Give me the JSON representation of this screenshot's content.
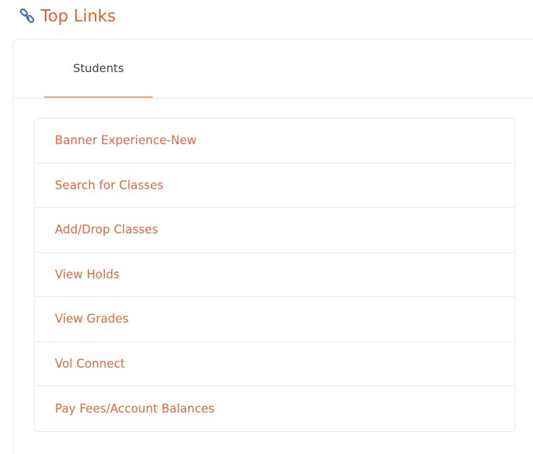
{
  "widget": {
    "title": "Top Links",
    "icon": "link-icon",
    "accent_color": "#e35f2e",
    "icon_color": "#4a6fc4"
  },
  "tabs": [
    {
      "label": "Students",
      "active": true
    }
  ],
  "links": [
    {
      "label": "Banner Experience-New"
    },
    {
      "label": "Search for Classes"
    },
    {
      "label": "Add/Drop Classes"
    },
    {
      "label": "View Holds"
    },
    {
      "label": "View Grades"
    },
    {
      "label": "Vol Connect"
    },
    {
      "label": "Pay Fees/Account Balances"
    }
  ]
}
